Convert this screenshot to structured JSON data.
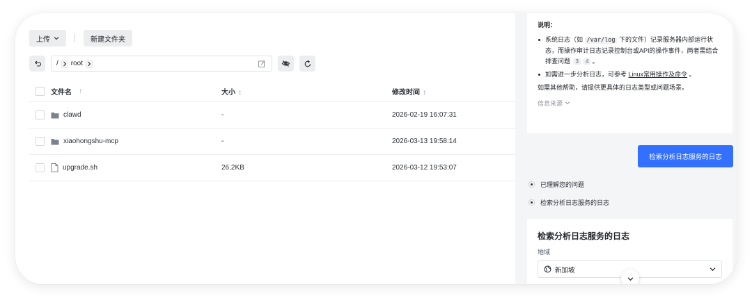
{
  "toolbar": {
    "upload_label": "上传",
    "new_folder_label": "新建文件夹"
  },
  "path": {
    "root_sep": "/",
    "segment": "root"
  },
  "table": {
    "headers": {
      "name": "文件名",
      "size": "大小",
      "modified": "修改时间"
    },
    "rows": [
      {
        "name": "clawd",
        "type": "folder",
        "size": "-",
        "modified": "2026-02-19 16:07:31"
      },
      {
        "name": "xiaohongshu-mcp",
        "type": "folder",
        "size": "-",
        "modified": "2026-03-13 19:58:14"
      },
      {
        "name": "upgrade.sh",
        "type": "file",
        "size": "26.2KB",
        "modified": "2026-03-12 19:53:07"
      }
    ]
  },
  "chat": {
    "note_title": "说明：",
    "bullet1": {
      "a": "系统日志（如 ",
      "code": "/var/log",
      "b": " 下的文件）记录服务器内部运行状态，而操作审计日志记录控制台或API的操作事件，两者需结合排查问题",
      "cite1": "3",
      "cite2": "4",
      "end": "。"
    },
    "bullet2": {
      "a": "如需进一步分析日志，可参考 ",
      "link": "Linux常用操作及命令",
      "end": " 。"
    },
    "help_text": "如需其他帮助，请提供更具体的日志类型或问题场景。",
    "source_label": "信息来源",
    "action_button": "检索分析日志服务的日志",
    "steps": [
      "已理解您的问题",
      "检索分析日志服务的日志"
    ],
    "card_title": "检索分析日志服务的日志",
    "region_label": "地域",
    "region_value": "新加坡"
  },
  "colors": {
    "primary": "#3370ff"
  },
  "icons": [
    "chevron-down-icon",
    "back-icon",
    "chevron-right-icon",
    "edit-icon",
    "eye-off-icon",
    "refresh-icon",
    "sort-arrow-icon",
    "folder-icon",
    "file-icon",
    "globe-icon"
  ]
}
